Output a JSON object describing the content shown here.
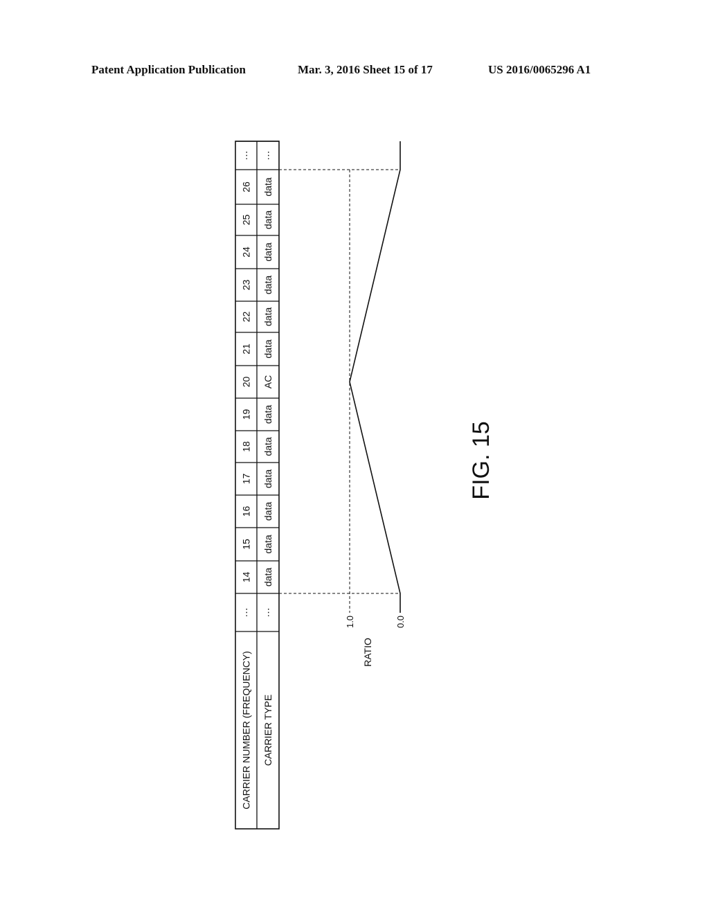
{
  "header": {
    "publication": "Patent Application Publication",
    "date_sheet": "Mar. 3, 2016   Sheet 15 of 17",
    "patent_number": "US 2016/0065296 A1"
  },
  "table": {
    "row_headers": [
      "CARRIER NUMBER (FREQUENCY)",
      "CARRIER TYPE"
    ],
    "columns": [
      {
        "number": "…",
        "type": "…"
      },
      {
        "number": "14",
        "type": "data"
      },
      {
        "number": "15",
        "type": "data"
      },
      {
        "number": "16",
        "type": "data"
      },
      {
        "number": "17",
        "type": "data"
      },
      {
        "number": "18",
        "type": "data"
      },
      {
        "number": "19",
        "type": "data"
      },
      {
        "number": "20",
        "type": "AC"
      },
      {
        "number": "21",
        "type": "data"
      },
      {
        "number": "22",
        "type": "data"
      },
      {
        "number": "23",
        "type": "data"
      },
      {
        "number": "24",
        "type": "data"
      },
      {
        "number": "25",
        "type": "data"
      },
      {
        "number": "26",
        "type": "data"
      },
      {
        "number": "…",
        "type": "…"
      }
    ]
  },
  "ratio_plot": {
    "axis_label": "RATIO",
    "tick_labels": [
      "0.0",
      "1.0"
    ],
    "profile": [
      {
        "carrier": "14",
        "ratio": 0.0
      },
      {
        "carrier": "20",
        "ratio": 1.0
      },
      {
        "carrier": "26",
        "ratio": 0.0
      }
    ]
  },
  "figure_label": "FIG. 15"
}
